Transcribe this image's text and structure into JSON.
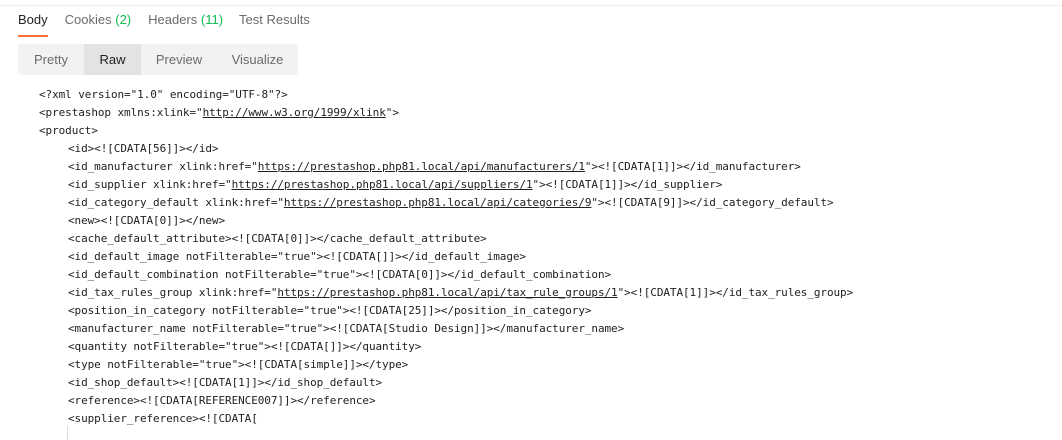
{
  "tabs": [
    {
      "label": "Body",
      "count": ""
    },
    {
      "label": "Cookies",
      "count": "(2)"
    },
    {
      "label": "Headers",
      "count": "(11)"
    },
    {
      "label": "Test Results",
      "count": ""
    }
  ],
  "view_modes": [
    "Pretty",
    "Raw",
    "Preview",
    "Visualize"
  ],
  "accent_color": "#ff6c37",
  "count_color": "#0cbb52",
  "code_lines": [
    {
      "indent": 0,
      "parts": [
        {
          "t": "<?xml version=\"1.0\" encoding=\"UTF-8\"?>"
        }
      ]
    },
    {
      "indent": 0,
      "parts": [
        {
          "t": "<prestashop xmlns:xlink=\""
        },
        {
          "t": "http://www.w3.org/1999/xlink",
          "u": true
        },
        {
          "t": "\">"
        }
      ]
    },
    {
      "indent": 0,
      "parts": [
        {
          "t": "<product>"
        }
      ]
    },
    {
      "indent": 1,
      "parts": [
        {
          "t": "<id><![CDATA[56]]></id>"
        }
      ]
    },
    {
      "indent": 1,
      "parts": [
        {
          "t": "<id_manufacturer xlink:href=\""
        },
        {
          "t": "https://prestashop.php81.local/api/manufacturers/1",
          "u": true
        },
        {
          "t": "\"><![CDATA[1]]></id_manufacturer>"
        }
      ]
    },
    {
      "indent": 1,
      "parts": [
        {
          "t": "<id_supplier xlink:href=\""
        },
        {
          "t": "https://prestashop.php81.local/api/suppliers/1",
          "u": true
        },
        {
          "t": "\"><![CDATA[1]]></id_supplier>"
        }
      ]
    },
    {
      "indent": 1,
      "parts": [
        {
          "t": "<id_category_default xlink:href=\""
        },
        {
          "t": "https://prestashop.php81.local/api/categories/9",
          "u": true
        },
        {
          "t": "\"><![CDATA[9]]></id_category_default>"
        }
      ]
    },
    {
      "indent": 1,
      "parts": [
        {
          "t": "<new><![CDATA[0]]></new>"
        }
      ]
    },
    {
      "indent": 1,
      "parts": [
        {
          "t": "<cache_default_attribute><![CDATA[0]]></cache_default_attribute>"
        }
      ]
    },
    {
      "indent": 1,
      "parts": [
        {
          "t": "<id_default_image notFilterable=\"true\"><![CDATA[]]></id_default_image>"
        }
      ]
    },
    {
      "indent": 1,
      "parts": [
        {
          "t": "<id_default_combination notFilterable=\"true\"><![CDATA[0]]></id_default_combination>"
        }
      ]
    },
    {
      "indent": 1,
      "parts": [
        {
          "t": "<id_tax_rules_group xlink:href=\""
        },
        {
          "t": "https://prestashop.php81.local/api/tax_rule_groups/1",
          "u": true
        },
        {
          "t": "\"><![CDATA[1]]></id_tax_rules_group>"
        }
      ]
    },
    {
      "indent": 1,
      "parts": [
        {
          "t": "<position_in_category notFilterable=\"true\"><![CDATA[25]]></position_in_category>"
        }
      ]
    },
    {
      "indent": 1,
      "parts": [
        {
          "t": "<manufacturer_name notFilterable=\"true\"><![CDATA[Studio Design]]></manufacturer_name>"
        }
      ]
    },
    {
      "indent": 1,
      "parts": [
        {
          "t": "<quantity notFilterable=\"true\"><![CDATA[]]></quantity>"
        }
      ]
    },
    {
      "indent": 1,
      "parts": [
        {
          "t": "<type notFilterable=\"true\"><![CDATA[simple]]></type>"
        }
      ]
    },
    {
      "indent": 1,
      "parts": [
        {
          "t": "<id_shop_default><![CDATA[1]]></id_shop_default>"
        }
      ]
    },
    {
      "indent": 1,
      "parts": [
        {
          "t": "<reference><![CDATA[REFERENCE007]]></reference>"
        }
      ]
    },
    {
      "indent": 1,
      "parts": [
        {
          "t": "<supplier_reference><![CDATA["
        }
      ]
    }
  ]
}
